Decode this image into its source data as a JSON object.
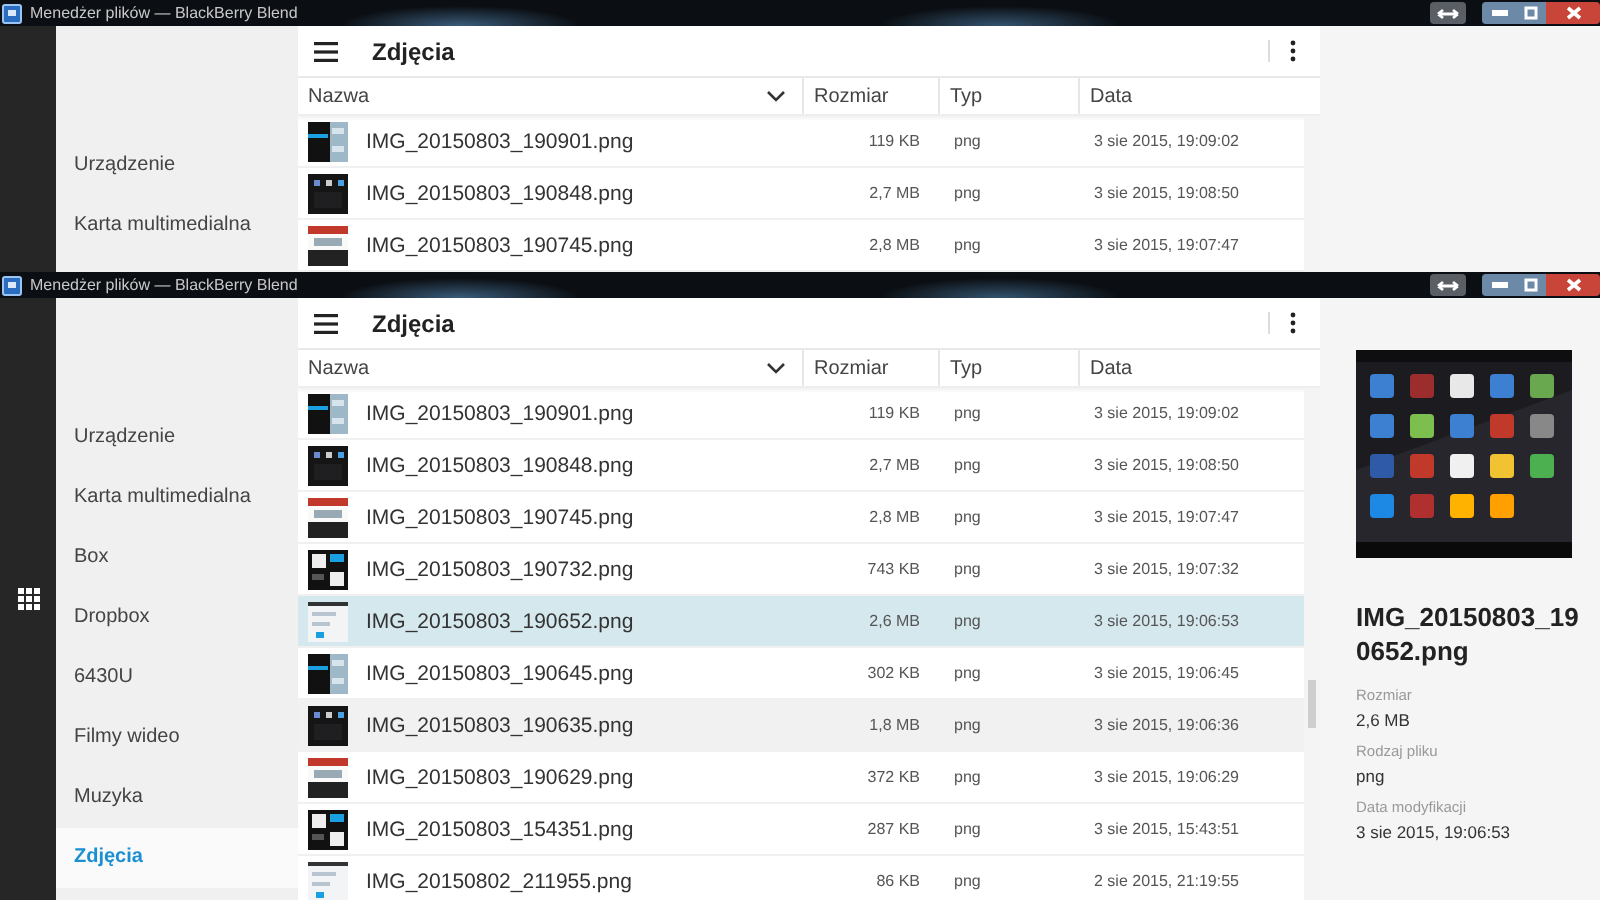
{
  "windows": [
    {
      "title": "Menedżer plików — BlackBerry Blend",
      "app_grid_icon": false,
      "header": {
        "title": "Zdjęcia"
      },
      "sidebar": {
        "items": [
          {
            "label": "Urządzenie",
            "selected": false
          },
          {
            "label": "Karta multimedialna",
            "selected": false
          }
        ]
      },
      "columns": [
        "Nazwa",
        "Rozmiar",
        "Typ",
        "Data"
      ],
      "rows": [
        {
          "name": "IMG_20150803_190901.png",
          "size": "119 KB",
          "type": "png",
          "date": "3 sie 2015, 19:09:02",
          "selected": false,
          "hovered": false
        },
        {
          "name": "IMG_20150803_190848.png",
          "size": "2,7 MB",
          "type": "png",
          "date": "3 sie 2015, 19:08:50",
          "selected": false,
          "hovered": false
        },
        {
          "name": "IMG_20150803_190745.png",
          "size": "2,8 MB",
          "type": "png",
          "date": "3 sie 2015, 19:07:47",
          "selected": false,
          "hovered": false
        }
      ]
    },
    {
      "title": "Menedżer plików — BlackBerry Blend",
      "app_grid_icon": true,
      "header": {
        "title": "Zdjęcia"
      },
      "sidebar": {
        "items": [
          {
            "label": "Urządzenie",
            "selected": false
          },
          {
            "label": "Karta multimedialna",
            "selected": false
          },
          {
            "label": "Box",
            "selected": false
          },
          {
            "label": "Dropbox",
            "selected": false
          },
          {
            "label": "6430U",
            "selected": false
          },
          {
            "label": "Filmy wideo",
            "selected": false
          },
          {
            "label": "Muzyka",
            "selected": false
          },
          {
            "label": "Zdjęcia",
            "selected": true
          }
        ]
      },
      "columns": [
        "Nazwa",
        "Rozmiar",
        "Typ",
        "Data"
      ],
      "rows": [
        {
          "name": "IMG_20150803_190901.png",
          "size": "119 KB",
          "type": "png",
          "date": "3 sie 2015, 19:09:02",
          "selected": false,
          "hovered": false
        },
        {
          "name": "IMG_20150803_190848.png",
          "size": "2,7 MB",
          "type": "png",
          "date": "3 sie 2015, 19:08:50",
          "selected": false,
          "hovered": false
        },
        {
          "name": "IMG_20150803_190745.png",
          "size": "2,8 MB",
          "type": "png",
          "date": "3 sie 2015, 19:07:47",
          "selected": false,
          "hovered": false
        },
        {
          "name": "IMG_20150803_190732.png",
          "size": "743 KB",
          "type": "png",
          "date": "3 sie 2015, 19:07:32",
          "selected": false,
          "hovered": false
        },
        {
          "name": "IMG_20150803_190652.png",
          "size": "2,6 MB",
          "type": "png",
          "date": "3 sie 2015, 19:06:53",
          "selected": true,
          "hovered": false
        },
        {
          "name": "IMG_20150803_190645.png",
          "size": "302 KB",
          "type": "png",
          "date": "3 sie 2015, 19:06:45",
          "selected": false,
          "hovered": false
        },
        {
          "name": "IMG_20150803_190635.png",
          "size": "1,8 MB",
          "type": "png",
          "date": "3 sie 2015, 19:06:36",
          "selected": false,
          "hovered": true
        },
        {
          "name": "IMG_20150803_190629.png",
          "size": "372 KB",
          "type": "png",
          "date": "3 sie 2015, 19:06:29",
          "selected": false,
          "hovered": false
        },
        {
          "name": "IMG_20150803_154351.png",
          "size": "287 KB",
          "type": "png",
          "date": "3 sie 2015, 15:43:51",
          "selected": false,
          "hovered": false
        },
        {
          "name": "IMG_20150802_211955.png",
          "size": "86 KB",
          "type": "png",
          "date": "2 sie 2015, 21:19:55",
          "selected": false,
          "hovered": false
        }
      ],
      "details": {
        "name": "IMG_20150803_190652.png",
        "fields": [
          {
            "label": "Rozmiar",
            "value": "2,6 MB"
          },
          {
            "label": "Rodzaj pliku",
            "value": "png"
          },
          {
            "label": "Data modyfikacji",
            "value": "3 sie 2015, 19:06:53"
          }
        ]
      }
    }
  ]
}
